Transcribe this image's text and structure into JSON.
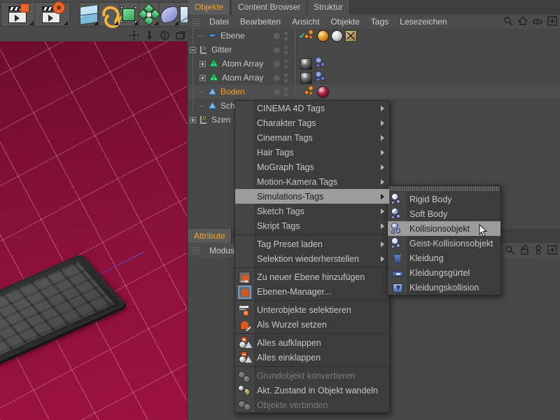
{
  "app": {
    "toolbar_groups": [
      {
        "name": "animation-tools",
        "buttons": [
          "render-view-icon",
          "render-settings-icon"
        ]
      },
      {
        "name": "mode-tools",
        "buttons": [
          "cube-model-icon",
          "texture-axis-icon",
          "object-axis-icon",
          "polygon-icon",
          "deformer-icon",
          "workplane-icon"
        ]
      }
    ]
  },
  "viewport": {
    "nav_icons": [
      "move-view-icon",
      "scale-view-icon",
      "rotate-view-icon",
      "maximize-view-icon"
    ],
    "background_color": "#8c1139",
    "objects": [
      "keyboard-mesh"
    ]
  },
  "object_manager": {
    "tabs": [
      {
        "label": "Objekte",
        "active": true
      },
      {
        "label": "Content Browser",
        "active": false
      },
      {
        "label": "Struktur",
        "active": false
      }
    ],
    "menu": [
      "Datei",
      "Bearbeiten",
      "Ansicht",
      "Objekte",
      "Tags",
      "Lesezeichen"
    ],
    "right_icons": [
      "search-icon",
      "home-icon",
      "eye-icon",
      "plus-box-icon"
    ],
    "rows": [
      {
        "label": "Ebene",
        "indent": 1,
        "toggle": "none",
        "icon": "plane-icon",
        "selected": false,
        "visible_check": true,
        "tags": [
          "particle-tag",
          "orange-material",
          "white-material",
          "texture-tag"
        ]
      },
      {
        "label": "Gitter",
        "indent": 0,
        "toggle": "minus",
        "icon": "null-icon",
        "selected": false,
        "visible_check": false,
        "tags": []
      },
      {
        "label": "Atom Array",
        "indent": 2,
        "toggle": "plus",
        "icon": "atom-array-icon",
        "selected": false,
        "visible_check": true,
        "tags": [
          "black-material",
          "dynamics-tag"
        ]
      },
      {
        "label": "Atom Array",
        "indent": 2,
        "toggle": "plus",
        "icon": "atom-array-icon",
        "selected": false,
        "visible_check": true,
        "tags": [
          "black-material",
          "dynamics-tag"
        ]
      },
      {
        "label": "Boden",
        "indent": 1,
        "toggle": "none",
        "icon": "floor-icon",
        "selected": true,
        "visible_check": false,
        "tags": [
          "particle-tag",
          "red-material"
        ]
      },
      {
        "label": "Scha",
        "indent": 1,
        "toggle": "none",
        "icon": "floor-icon",
        "selected": false,
        "visible_check": false,
        "tags": []
      },
      {
        "label": "Szen",
        "indent": 0,
        "toggle": "plus",
        "icon": "null-icon",
        "selected": false,
        "visible_check": false,
        "tags": []
      }
    ]
  },
  "attribute_manager": {
    "tab": "Attribute",
    "menu": [
      "Modus"
    ],
    "right_icons": [
      "search-icon",
      "lock-icon",
      "link-icon",
      "plus-box-icon"
    ]
  },
  "context_menu": {
    "items": [
      {
        "label": "CINEMA 4D Tags",
        "submenu": true,
        "icon": null,
        "disabled": false,
        "highlighted": false
      },
      {
        "label": "Charakter Tags",
        "submenu": true,
        "icon": null,
        "disabled": false,
        "highlighted": false
      },
      {
        "label": "Cineman Tags",
        "submenu": true,
        "icon": null,
        "disabled": false,
        "highlighted": false
      },
      {
        "label": "Hair Tags",
        "submenu": true,
        "icon": null,
        "disabled": false,
        "highlighted": false
      },
      {
        "label": "MoGraph Tags",
        "submenu": true,
        "icon": null,
        "disabled": false,
        "highlighted": false
      },
      {
        "label": "Motion-Kamera Tags",
        "submenu": true,
        "icon": null,
        "disabled": false,
        "highlighted": false
      },
      {
        "label": "Simulations-Tags",
        "submenu": true,
        "icon": null,
        "disabled": false,
        "highlighted": true
      },
      {
        "label": "Sketch Tags",
        "submenu": true,
        "icon": null,
        "disabled": false,
        "highlighted": false
      },
      {
        "label": "Skript Tags",
        "submenu": true,
        "icon": null,
        "disabled": false,
        "highlighted": false
      },
      {
        "separator": true
      },
      {
        "label": "Tag Preset laden",
        "submenu": true,
        "icon": null,
        "disabled": false,
        "highlighted": false
      },
      {
        "label": "Selektion wiederherstellen",
        "submenu": true,
        "icon": null,
        "disabled": false,
        "highlighted": false
      },
      {
        "separator": true
      },
      {
        "label": "Zu neuer Ebene hinzufügen",
        "submenu": false,
        "icon": "add-layer-icon",
        "disabled": false,
        "highlighted": false
      },
      {
        "label": "Ebenen-Manager...",
        "submenu": false,
        "icon": "layer-manager-icon",
        "disabled": false,
        "highlighted": false
      },
      {
        "separator": true
      },
      {
        "label": "Unterobjekte selektieren",
        "submenu": false,
        "icon": "select-children-icon",
        "disabled": false,
        "highlighted": false
      },
      {
        "label": "Als Wurzel setzen",
        "submenu": false,
        "icon": "set-root-icon",
        "disabled": false,
        "highlighted": false
      },
      {
        "separator": true
      },
      {
        "label": "Alles aufklappen",
        "submenu": false,
        "icon": "expand-all-icon",
        "disabled": false,
        "highlighted": false
      },
      {
        "label": "Alles einklappen",
        "submenu": false,
        "icon": "collapse-all-icon",
        "disabled": false,
        "highlighted": false
      },
      {
        "separator": true
      },
      {
        "label": "Grundobjekt konvertieren",
        "submenu": false,
        "icon": "convert-primitive-icon",
        "disabled": true,
        "highlighted": false
      },
      {
        "label": "Akt. Zustand in Objekt wandeln",
        "submenu": false,
        "icon": "current-state-icon",
        "disabled": false,
        "highlighted": false
      },
      {
        "label": "Objekte verbinden",
        "submenu": false,
        "icon": "connect-objects-icon",
        "disabled": true,
        "highlighted": false
      }
    ]
  },
  "submenu": {
    "title": "Simulations-Tags",
    "items": [
      {
        "label": "Rigid Body",
        "icon": "rigid-body-icon",
        "highlighted": false
      },
      {
        "label": "Soft Body",
        "icon": "soft-body-icon",
        "highlighted": false
      },
      {
        "label": "Kollisionsobjekt",
        "icon": "collider-icon",
        "highlighted": true
      },
      {
        "label": "Geist-Kollisionsobjekt",
        "icon": "ghost-collider-icon",
        "highlighted": false
      },
      {
        "label": "Kleidung",
        "icon": "cloth-icon",
        "highlighted": false
      },
      {
        "label": "Kleidungsgürtel",
        "icon": "cloth-belt-icon",
        "highlighted": false
      },
      {
        "label": "Kleidungskollision",
        "icon": "cloth-collider-icon",
        "highlighted": false
      }
    ]
  },
  "colors": {
    "panel_bg": "#474747",
    "menu_bg": "#3c3c3c",
    "highlight": "#9c9c9c",
    "accent_orange": "#f0a32a",
    "check_green": "#49d07a",
    "viewport_red": "#8c1139"
  }
}
